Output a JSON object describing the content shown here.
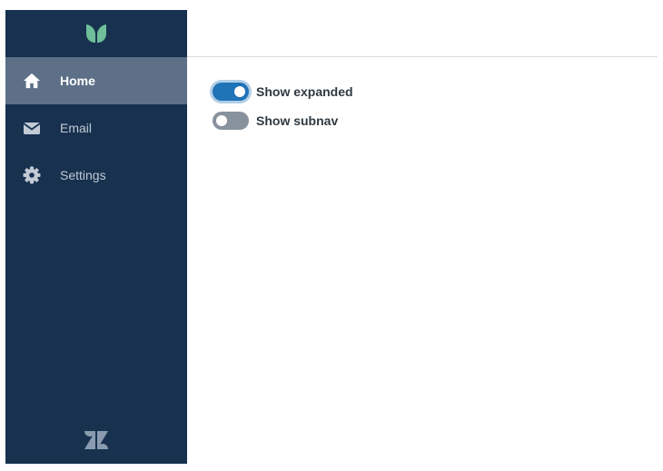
{
  "nav": {
    "brand_icon": "leaf-product-icon",
    "items": [
      {
        "label": "Home",
        "icon": "home-icon",
        "current": true
      },
      {
        "label": "Email",
        "icon": "envelope-icon",
        "current": false
      },
      {
        "label": "Settings",
        "icon": "gear-icon",
        "current": false
      }
    ],
    "footer_icon": "zendesk-logo-icon"
  },
  "main": {
    "toggles": [
      {
        "label": "Show expanded",
        "checked": true
      },
      {
        "label": "Show subnav",
        "checked": false
      }
    ]
  },
  "colors": {
    "nav_background": "#17314f",
    "nav_current_item": "#5d7088",
    "brand_accent": "#78a300",
    "toggle_on": "#1f73b7",
    "toggle_off": "#87929d"
  }
}
